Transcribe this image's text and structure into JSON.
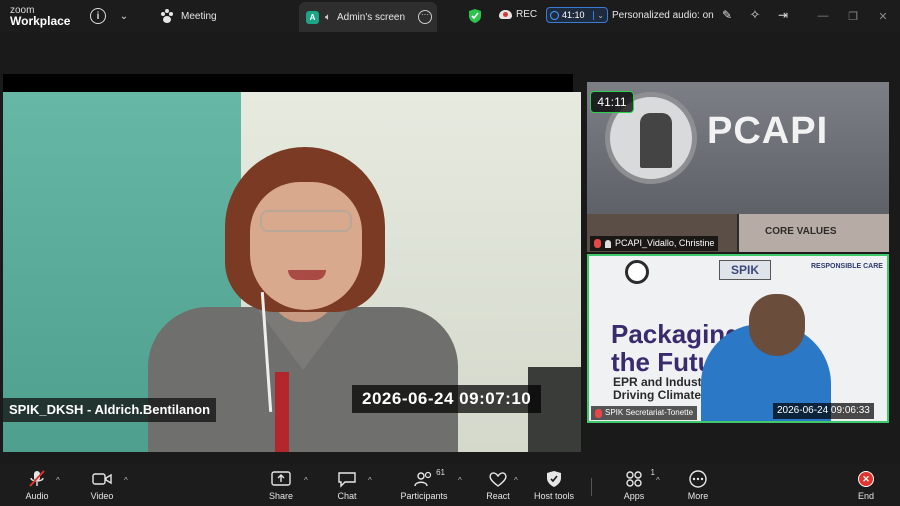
{
  "app": {
    "logo_top": "zoom",
    "logo_bottom": "Workplace"
  },
  "titlebar": {
    "meeting_tab": "Meeting",
    "screen_tab": "Admin's screen",
    "screen_tab_avatar": "A",
    "rec_label": "REC",
    "timer": "41:10",
    "audio_status": "Personalized audio: on"
  },
  "main_video": {
    "participant": "SPIK_DKSH - Aldrich.Bentilanon",
    "timestamp": "2026-06-24  09:07:10"
  },
  "thumb1": {
    "timer": "41:11",
    "participant": "PCAPI_Vidallo, Christine",
    "wall_text": "PCAPI",
    "core_values": "CORE VALUES"
  },
  "thumb2": {
    "participant": "SPIK Secretariat-Tonette",
    "timestamp": "2026-06-24  09:06:33",
    "spik_logo": "SPIK",
    "rc_line1": "RESPONSIBLE CARE",
    "title_line1": "Packaging",
    "title_line2": "the Future",
    "sub_line1": "EPR and Industry In",
    "sub_line2": "Driving Climate"
  },
  "toolbar": {
    "audio": "Audio",
    "video": "Video",
    "share": "Share",
    "chat": "Chat",
    "participants": "Participants",
    "participants_count": "61",
    "react": "React",
    "host_tools": "Host tools",
    "apps": "Apps",
    "apps_count": "1",
    "more": "More",
    "end": "End"
  },
  "colors": {
    "accent_blue": "#3a7bd5",
    "active_green": "#3fc86c",
    "end_red": "#e0342f"
  }
}
